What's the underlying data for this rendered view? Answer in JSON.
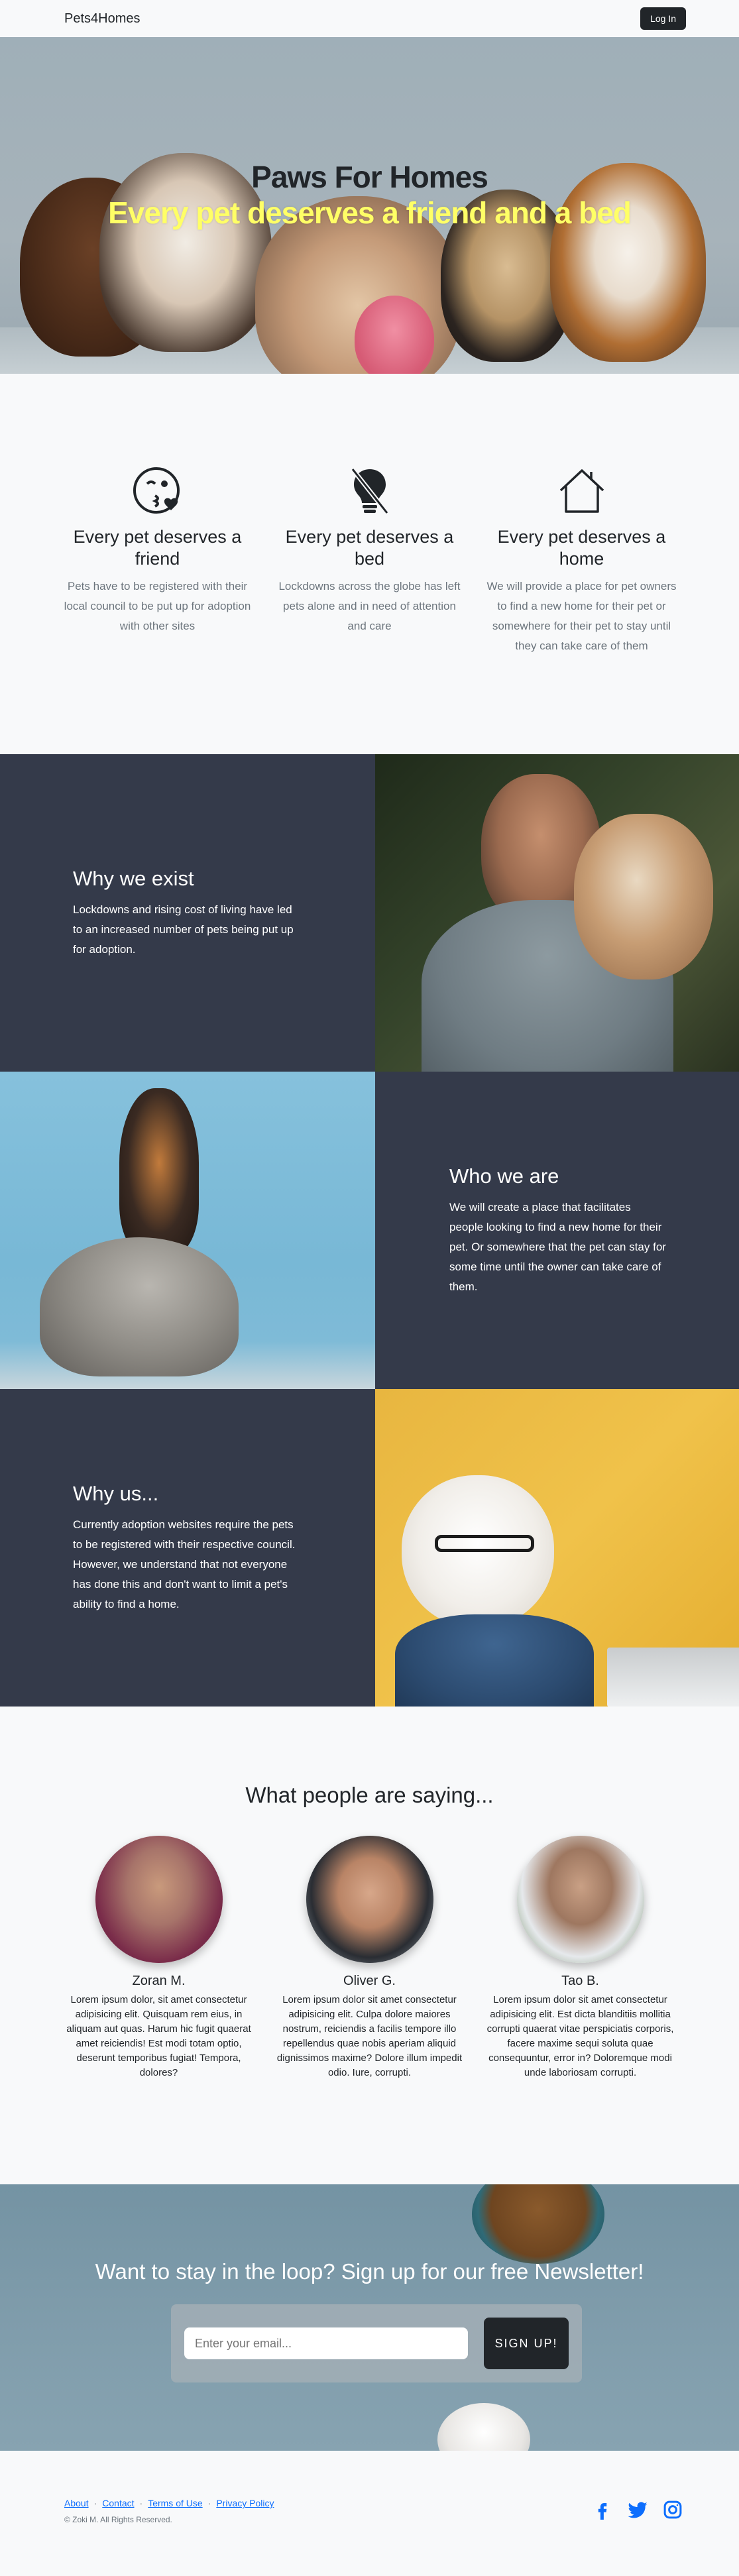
{
  "navbar": {
    "brand": "Pets4Homes",
    "login_label": "Log In"
  },
  "hero": {
    "title": "Paws For Homes",
    "subtitle": "Every pet deserves a friend and a bed"
  },
  "features": [
    {
      "icon": "emoji-wink-kiss-icon",
      "title": "Every pet deserves a friend",
      "text": "Pets have to be registered with their local council to be put up for adoption with other sites"
    },
    {
      "icon": "lightbulb-off-icon",
      "title": "Every pet deserves a bed",
      "text": "Lockdowns across the globe has left pets alone and in need of attention and care"
    },
    {
      "icon": "house-icon",
      "title": "Every pet deserves a home",
      "text": "We will provide a place for pet owners to find a new home for their pet or somewhere for their pet to stay until they can take care of them"
    }
  ],
  "showcase": [
    {
      "heading": "Why we exist",
      "text": "Lockdowns and rising cost of living have led to an increased number of pets being put up for adoption."
    },
    {
      "heading": "Who we are",
      "text": "We will create a place that facilitates people looking to find a new home for their pet. Or somewhere that the pet can stay for some time until the owner can take care of them."
    },
    {
      "heading": "Why us...",
      "text": "Currently adoption websites require the pets to be registered with their respective council. However, we understand that not everyone has done this and don't want to limit a pet's ability to find a home."
    }
  ],
  "testimonials": {
    "heading": "What people are saying...",
    "items": [
      {
        "name": "Zoran M.",
        "text": "Lorem ipsum dolor, sit amet consectetur adipisicing elit. Quisquam rem eius, in aliquam aut quas. Harum hic fugit quaerat amet reiciendis! Est modi totam optio, deserunt temporibus fugiat! Tempora, dolores?"
      },
      {
        "name": "Oliver G.",
        "text": "Lorem ipsum dolor sit amet consectetur adipisicing elit. Culpa dolore maiores nostrum, reiciendis a facilis tempore illo repellendus quae nobis aperiam aliquid dignissimos maxime? Dolore illum impedit odio. Iure, corrupti."
      },
      {
        "name": "Tao B.",
        "text": "Lorem ipsum dolor sit amet consectetur adipisicing elit. Est dicta blanditiis mollitia corrupti quaerat vitae perspiciatis corporis, facere maxime sequi soluta quae consequuntur, error in? Doloremque modi unde laboriosam corrupti."
      }
    ]
  },
  "cta": {
    "heading": "Want to stay in the loop? Sign up for our free Newsletter!",
    "email_placeholder": "Enter your email...",
    "signup_label": "SIGN UP!"
  },
  "footer": {
    "links": [
      "About",
      "Contact",
      "Terms of Use",
      "Privacy Policy"
    ],
    "copyright": "© Zoki M. All Rights Reserved.",
    "social_icons": [
      "facebook-icon",
      "twitter-icon",
      "instagram-icon"
    ]
  },
  "colors": {
    "dark_panel": "#343a4a",
    "hero_subtitle": "#ffff66",
    "social": "#0d6efd"
  }
}
